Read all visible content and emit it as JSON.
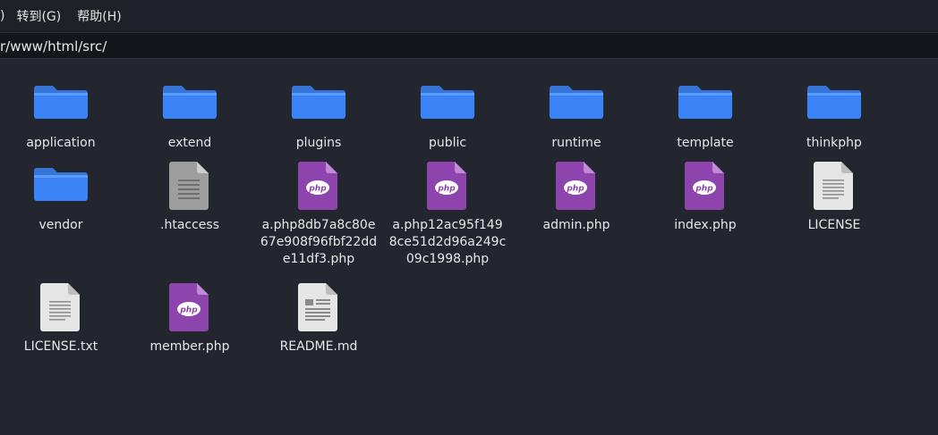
{
  "menubar": {
    "items": [
      {
        "label": ")"
      },
      {
        "label": "转到(G)"
      },
      {
        "label": "帮助(H)"
      }
    ]
  },
  "address": {
    "path": "r/www/html/src/"
  },
  "colors": {
    "folder": "#3b82f6",
    "php": "#8e44ad",
    "document": "#e5e5e5"
  },
  "files": [
    {
      "name": "application",
      "type": "folder",
      "icon": "folder-icon"
    },
    {
      "name": "extend",
      "type": "folder",
      "icon": "folder-icon"
    },
    {
      "name": "plugins",
      "type": "folder",
      "icon": "folder-icon"
    },
    {
      "name": "public",
      "type": "folder",
      "icon": "folder-icon"
    },
    {
      "name": "runtime",
      "type": "folder",
      "icon": "folder-icon"
    },
    {
      "name": "template",
      "type": "folder",
      "icon": "folder-icon"
    },
    {
      "name": "thinkphp",
      "type": "folder",
      "icon": "folder-icon"
    },
    {
      "name": "vendor",
      "type": "folder",
      "icon": "folder-icon"
    },
    {
      "name": ".htaccess",
      "type": "config",
      "icon": "config-file-icon"
    },
    {
      "name": "a.php8db7a8c80e67e908f96fbf22dde11df3.php",
      "type": "php",
      "icon": "php-file-icon"
    },
    {
      "name": "a.php12ac95f1498ce51d2d96a249c09c1998.php",
      "type": "php",
      "icon": "php-file-icon"
    },
    {
      "name": "admin.php",
      "type": "php",
      "icon": "php-file-icon"
    },
    {
      "name": "index.php",
      "type": "php",
      "icon": "php-file-icon"
    },
    {
      "name": "LICENSE",
      "type": "text",
      "icon": "text-file-icon"
    },
    {
      "name": "LICENSE.txt",
      "type": "text",
      "icon": "text-file-icon"
    },
    {
      "name": "member.php",
      "type": "php",
      "icon": "php-file-icon"
    },
    {
      "name": "README.md",
      "type": "markdown",
      "icon": "markdown-file-icon"
    }
  ]
}
